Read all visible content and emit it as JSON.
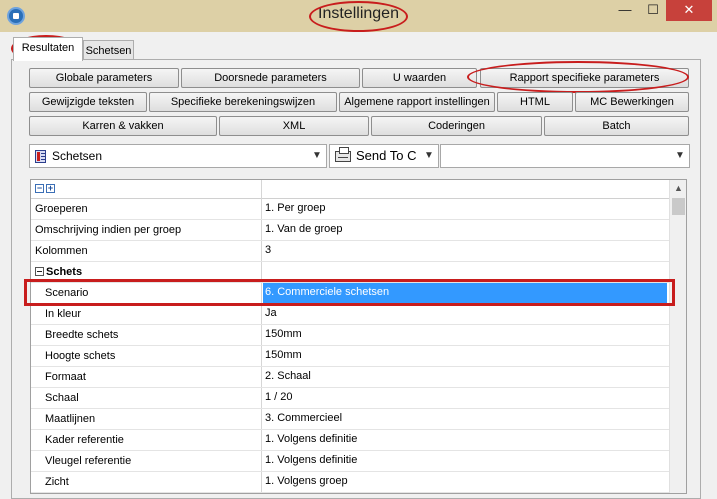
{
  "window": {
    "title": "Instellingen",
    "minimize_glyph": "—",
    "maximize_glyph": "☐",
    "close_glyph": "✕"
  },
  "tabs": [
    {
      "label": "Resultaten",
      "active": true
    },
    {
      "label": "Schetsen",
      "active": false
    }
  ],
  "button_rows": [
    [
      "Globale parameters",
      "Doorsnede parameters",
      "U waarden",
      "Rapport specifieke parameters"
    ],
    [
      "Gewijzigde teksten",
      "Specifieke berekeningswijzen",
      "Algemene rapport instellingen",
      "HTML",
      "MC Bewerkingen"
    ],
    [
      "Karren & vakken",
      "XML",
      "Coderingen",
      "Batch"
    ]
  ],
  "toolbar": {
    "report_select": "Schetsen",
    "output_select": "Send To C",
    "third_select": ""
  },
  "grid": {
    "expand_glyph": "+",
    "collapse_glyph": "−",
    "rows": [
      {
        "key": "Groeperen",
        "value": "1. Per groep"
      },
      {
        "key": "Omschrijving indien per groep",
        "value": "1. Van de groep"
      },
      {
        "key": "Kolommen",
        "value": "3"
      },
      {
        "key": "Schets",
        "value": ""
      },
      {
        "key": "Scenario",
        "value": "6. Commerciele schetsen"
      },
      {
        "key": "In kleur",
        "value": "Ja"
      },
      {
        "key": "Breedte schets",
        "value": "150mm"
      },
      {
        "key": "Hoogte schets",
        "value": "150mm"
      },
      {
        "key": "Formaat",
        "value": "2. Schaal"
      },
      {
        "key": "Schaal",
        "value": "1 / 20"
      },
      {
        "key": "Maatlijnen",
        "value": "3. Commercieel"
      },
      {
        "key": "Kader referentie",
        "value": "1. Volgens definitie"
      },
      {
        "key": "Vleugel referentie",
        "value": "1. Volgens definitie"
      },
      {
        "key": "Zicht",
        "value": "1. Volgens groep"
      }
    ]
  }
}
